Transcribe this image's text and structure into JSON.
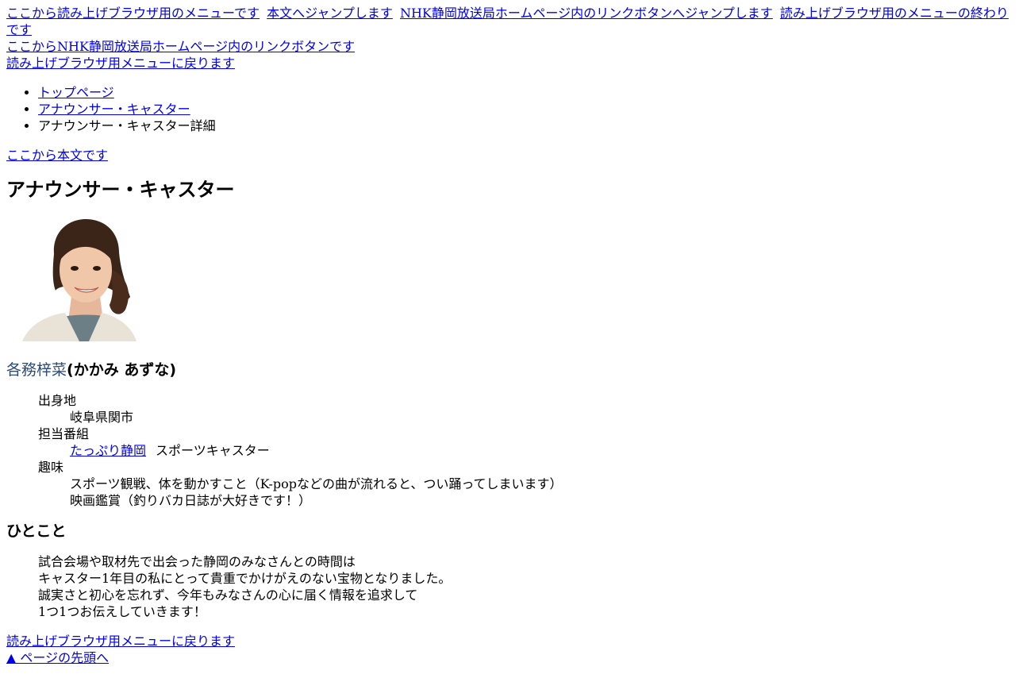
{
  "skip_menu": {
    "link_reader_menu": "ここから読み上げブラウザ用のメニューです",
    "link_jump_body": "本文へジャンプします",
    "link_jump_nhk_links": "NHK静岡放送局ホームページ内のリンクボタンへジャンプします",
    "link_reader_menu_end": "読み上げブラウザ用のメニューの終わりです"
  },
  "nhk_links_start": "ここからNHK静岡放送局ホームページ内のリンクボタンです",
  "back_to_reader_menu_top": "読み上げブラウザ用メニューに戻ります",
  "breadcrumb": {
    "items": [
      "トップページ",
      "アナウンサー・キャスター",
      "アナウンサー・キャスター詳細"
    ]
  },
  "body_start": "ここから本文です",
  "page_title": "アナウンサー・キャスター",
  "profile": {
    "name": "各務梓菜",
    "reading": "(かかみ あずな)",
    "birthplace_label": "出身地",
    "birthplace_value": "岐阜県関市",
    "program_label": "担当番組",
    "program_link": "たっぷり静岡",
    "program_role": "スポーツキャスター",
    "hobby_label": "趣味",
    "hobby_1": "スポーツ観戦、体を動かすこと（K-popなどの曲が流れると、つい踊ってしまいます）",
    "hobby_2": "映画鑑賞（釣りバカ日誌が大好きです！）"
  },
  "hitokoto": {
    "heading": "ひとこと",
    "lines": [
      "試合会場や取材先で出会った静岡のみなさんとの時間は",
      "キャスター1年目の私にとって貴重でかけがえのない宝物となりました。",
      "誠実さと初心を忘れず、今年もみなさんの心に届く情報を追求して",
      "1つ1つお伝えしていきます！"
    ]
  },
  "back_to_reader_menu_bottom": "読み上げブラウザ用メニューに戻ります",
  "page_top": "▲ ページの先頭へ",
  "colors": {
    "link": "#0000ee",
    "name": "#2c4a7a",
    "jacket": "#e9e2d6",
    "top": "#6c7f86"
  }
}
